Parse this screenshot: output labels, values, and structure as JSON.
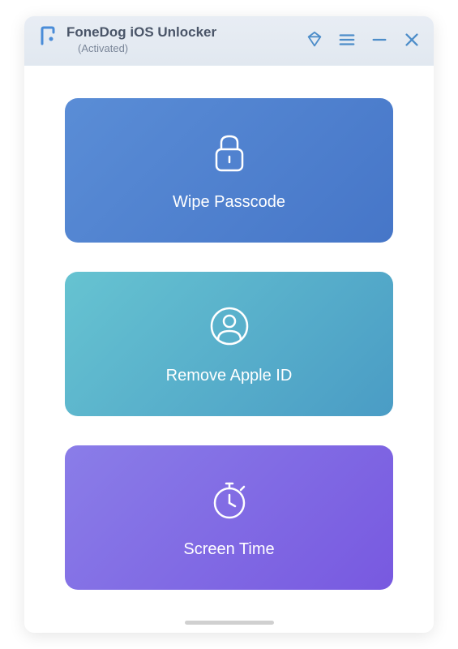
{
  "header": {
    "title": "FoneDog iOS Unlocker",
    "status": "(Activated)"
  },
  "actions": {
    "wipe": {
      "label": "Wipe Passcode"
    },
    "apple": {
      "label": "Remove Apple ID"
    },
    "screentime": {
      "label": "Screen Time"
    }
  }
}
